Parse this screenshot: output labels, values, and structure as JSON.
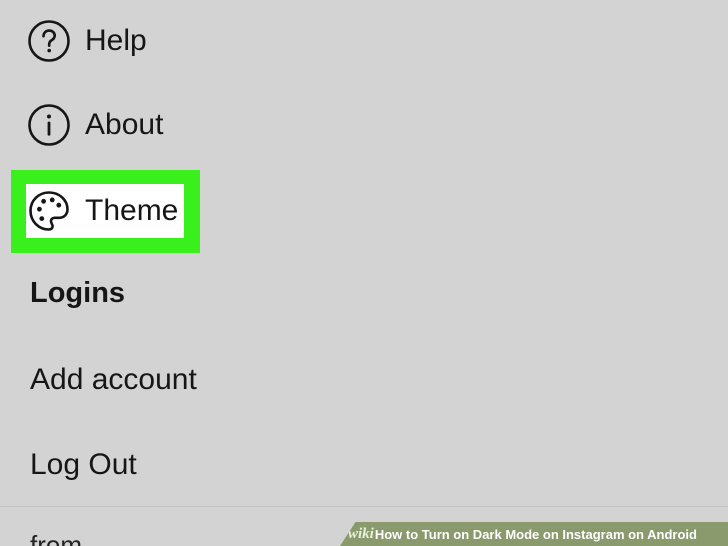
{
  "menu": {
    "help_label": "Help",
    "about_label": "About",
    "theme_label": "Theme",
    "logins_heading": "Logins",
    "add_account_label": "Add account",
    "log_out_label": "Log Out",
    "from_label": "from"
  },
  "icons": {
    "help": "question-circle-icon",
    "about": "info-circle-icon",
    "theme": "palette-icon"
  },
  "colors": {
    "background": "#d3d3d3",
    "highlight": "#39ef1c",
    "selected_item_bg": "#ffffff"
  },
  "watermark": {
    "brand": "wiki",
    "text": "How to Turn on Dark Mode on Instagram on Android"
  }
}
